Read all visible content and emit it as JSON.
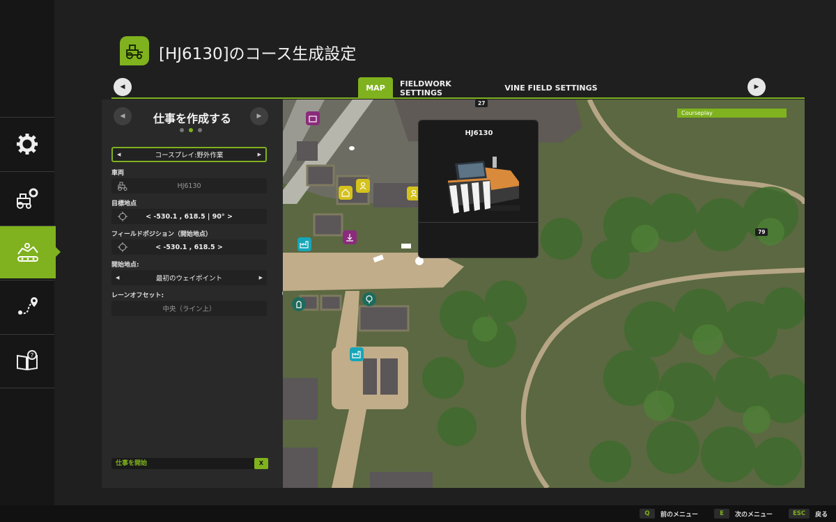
{
  "header": {
    "title": "[HJ6130]のコース生成設定"
  },
  "tabs": [
    {
      "label": "MAP"
    },
    {
      "label": "FIELDWORK SETTINGS"
    },
    {
      "label": "VINE FIELD SETTINGS"
    }
  ],
  "sidebar": {
    "items": [
      {
        "icon": "gear-icon"
      },
      {
        "icon": "tractor-gear-icon"
      },
      {
        "icon": "map-field-icon"
      },
      {
        "icon": "route-pin-icon"
      },
      {
        "icon": "manual-book-icon"
      }
    ],
    "active_index": 2
  },
  "panel": {
    "title": "仕事を作成する",
    "page_dots": 3,
    "active_dot": 1,
    "job_selector": "コースプレイ:野外作業",
    "vehicle_label": "車両",
    "vehicle_value": "HJ6130",
    "target_label": "目標地点",
    "target_value": "< -530.1 , 618.5 | 90° >",
    "field_pos_label": "フィールドポジション（開始地点）",
    "field_pos_value": "< -530.1 , 618.5 >",
    "start_label": "開始地点:",
    "start_value": "最初のウェイポイント",
    "lane_label": "レーンオフセット:",
    "lane_value": "中央（ライン上）",
    "start_job_label": "仕事を開始",
    "start_job_key": "X"
  },
  "map": {
    "field_number_top": "27",
    "field_number_right": "79",
    "courseplay_label": "Courseplay"
  },
  "popup": {
    "title": "HJ6130"
  },
  "footer": {
    "hints": [
      {
        "key": "Q",
        "label": "前のメニュー"
      },
      {
        "key": "E",
        "label": "次のメニュー"
      },
      {
        "key": "ESC",
        "label": "戻る"
      }
    ]
  },
  "colors": {
    "accent": "#7fb21e",
    "background": "#1f1f1f",
    "panel": "#292929"
  }
}
